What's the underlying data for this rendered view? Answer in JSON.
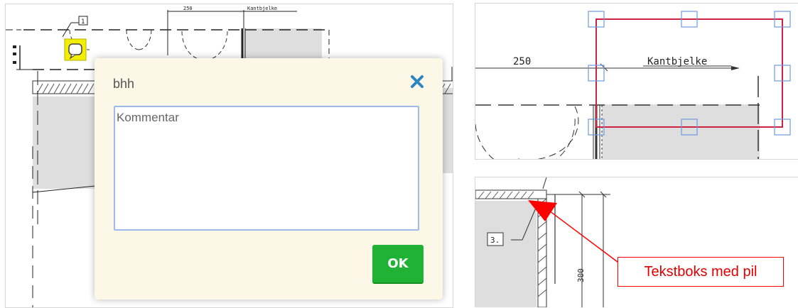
{
  "left_drawing": {
    "dim_label": "250",
    "beam_label": "Kantbjelke",
    "marker_number": "1"
  },
  "dialog": {
    "title": "bhh",
    "comment_value": "Kommentar",
    "ok_label": "OK"
  },
  "top_right": {
    "dim_label": "250",
    "beam_label": "Kantbjelke"
  },
  "bottom_right": {
    "marker_label": "3.",
    "dim_label": "300",
    "callout_text": "Tekstboks med pil"
  },
  "colors": {
    "dialog_bg": "#fcf7e6",
    "ok_green": "#1fb234",
    "close_blue": "#2e86c1",
    "selection_red": "#cc2244",
    "handle_blue": "#6a9be0",
    "callout_red": "#ff0000",
    "fill_gray": "#dedede"
  },
  "icons": [
    "close-icon",
    "marker-icon"
  ]
}
